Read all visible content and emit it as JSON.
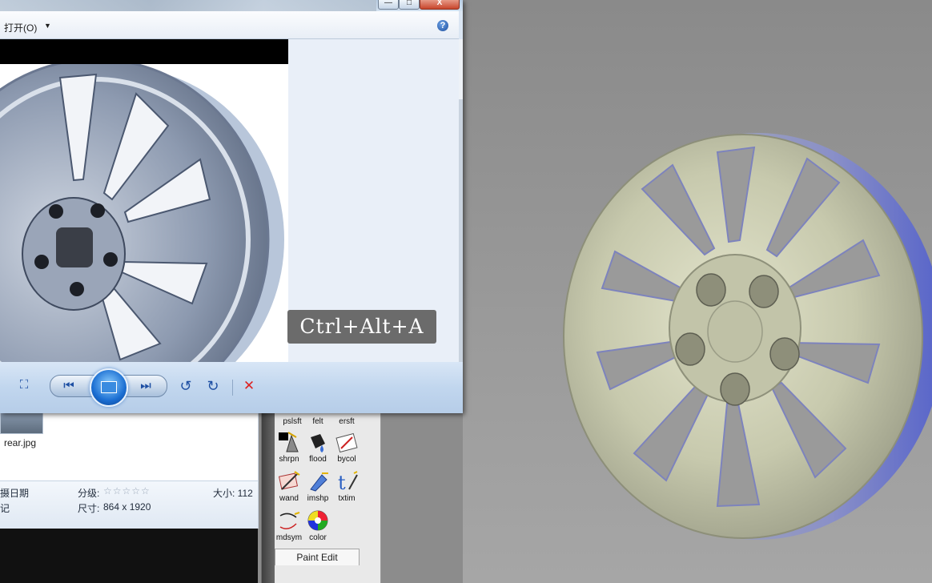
{
  "viewer": {
    "menu_open": "打开(O)",
    "menu_open_arrow": "▼",
    "help": "?",
    "minimize": "—",
    "maximize": "□",
    "close": "X",
    "shortcut_tip": "Ctrl+Alt+A",
    "toolbar": {
      "fit_icon": "⛶",
      "prev_icon": "⏮",
      "next_icon": "⏭",
      "rotate_left_icon": "↺",
      "rotate_right_icon": "↻",
      "delete_icon": "✕"
    }
  },
  "explorer": {
    "filename": "rear.jpg",
    "date_label": "摄日期",
    "rating_label": "分级:",
    "rating_stars": "☆☆☆☆☆",
    "size_label": "大小: 112",
    "note_label": "记",
    "dimensions_label": "尺寸:",
    "dimensions_value": "864 x 1920"
  },
  "palette": {
    "top_row": [
      "pslsft",
      "felt",
      "ersft"
    ],
    "tools": [
      {
        "label": "shrpn",
        "icon": "sharpen-icon"
      },
      {
        "label": "flood",
        "icon": "flood-icon"
      },
      {
        "label": "bycol",
        "icon": "by-color-icon"
      },
      {
        "label": "wand",
        "icon": "wand-icon"
      },
      {
        "label": "imshp",
        "icon": "image-shape-icon"
      },
      {
        "label": "txtim",
        "icon": "text-image-icon"
      },
      {
        "label": "mdsym",
        "icon": "mirror-symmetry-icon"
      },
      {
        "label": "color",
        "icon": "color-wheel-icon"
      }
    ],
    "tab": "Paint Edit"
  },
  "colors": {
    "viewport_bg": "#9a9a9a",
    "wheel_face": "#c9cbb0",
    "wheel_rim_blue": "#6f7fd6",
    "tip_bg": "#6b6b6b"
  }
}
